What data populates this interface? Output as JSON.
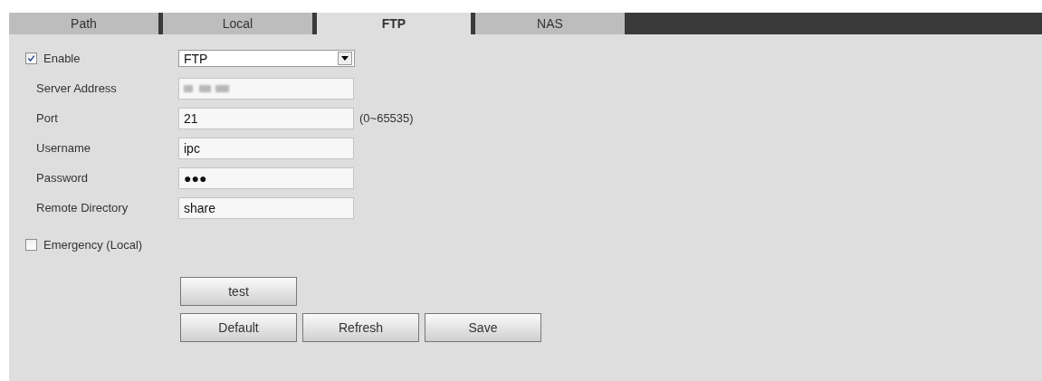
{
  "tabs": [
    {
      "label": "Path",
      "selected": false
    },
    {
      "label": "Local",
      "selected": false
    },
    {
      "label": "FTP",
      "selected": true
    },
    {
      "label": "NAS",
      "selected": false
    }
  ],
  "enable": {
    "label": "Enable",
    "checked": true
  },
  "fields": [
    {
      "kind": "select",
      "value": "FTP"
    },
    {
      "kind": "redacted",
      "label": "Server Address"
    },
    {
      "kind": "text",
      "label": "Port",
      "value": "21",
      "hint": "(0~65535)"
    },
    {
      "kind": "text",
      "label": "Username",
      "value": "ipc"
    },
    {
      "kind": "password",
      "label": "Password",
      "value": "●●●"
    },
    {
      "kind": "text",
      "label": "Remote Directory",
      "value": "share"
    }
  ],
  "emergency": {
    "label": "Emergency (Local)",
    "checked": false
  },
  "test_button": "test",
  "buttons": [
    "Default",
    "Refresh",
    "Save"
  ]
}
